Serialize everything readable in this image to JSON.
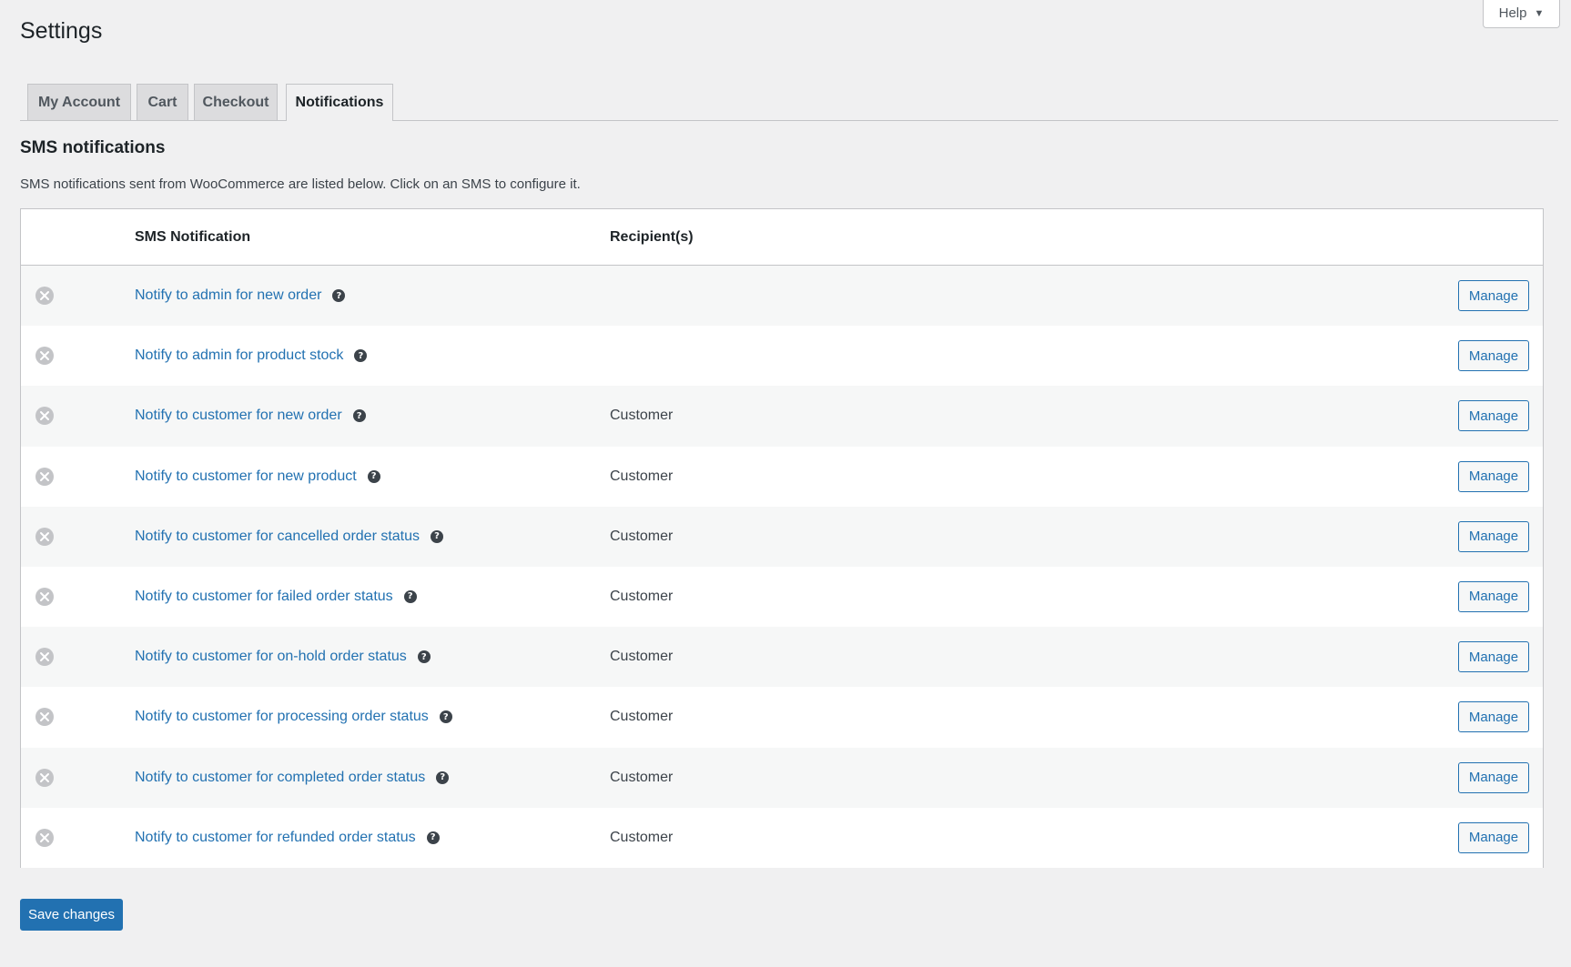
{
  "help": {
    "label": "Help"
  },
  "page": {
    "title": "Settings"
  },
  "tabs": [
    {
      "label": "My Account"
    },
    {
      "label": "Cart"
    },
    {
      "label": "Checkout"
    },
    {
      "label": "Notifications"
    }
  ],
  "section": {
    "title": "SMS notifications",
    "description": "SMS notifications sent from WooCommerce are listed below. Click on an SMS to configure it."
  },
  "table": {
    "headers": {
      "name": "SMS Notification",
      "recipients": "Recipient(s)"
    },
    "rows": [
      {
        "name": "Notify to admin for new order",
        "recipient": "",
        "action": "Manage"
      },
      {
        "name": "Notify to admin for product stock",
        "recipient": "",
        "action": "Manage"
      },
      {
        "name": "Notify to customer for new order",
        "recipient": "Customer",
        "action": "Manage"
      },
      {
        "name": "Notify to customer for new product",
        "recipient": "Customer",
        "action": "Manage"
      },
      {
        "name": "Notify to customer for cancelled order status",
        "recipient": "Customer",
        "action": "Manage"
      },
      {
        "name": "Notify to customer for failed order status",
        "recipient": "Customer",
        "action": "Manage"
      },
      {
        "name": "Notify to customer for on-hold order status",
        "recipient": "Customer",
        "action": "Manage"
      },
      {
        "name": "Notify to customer for processing order status",
        "recipient": "Customer",
        "action": "Manage"
      },
      {
        "name": "Notify to customer for completed order status",
        "recipient": "Customer",
        "action": "Manage"
      },
      {
        "name": "Notify to customer for refunded order status",
        "recipient": "Customer",
        "action": "Manage"
      }
    ]
  },
  "footer": {
    "save_label": "Save changes"
  }
}
